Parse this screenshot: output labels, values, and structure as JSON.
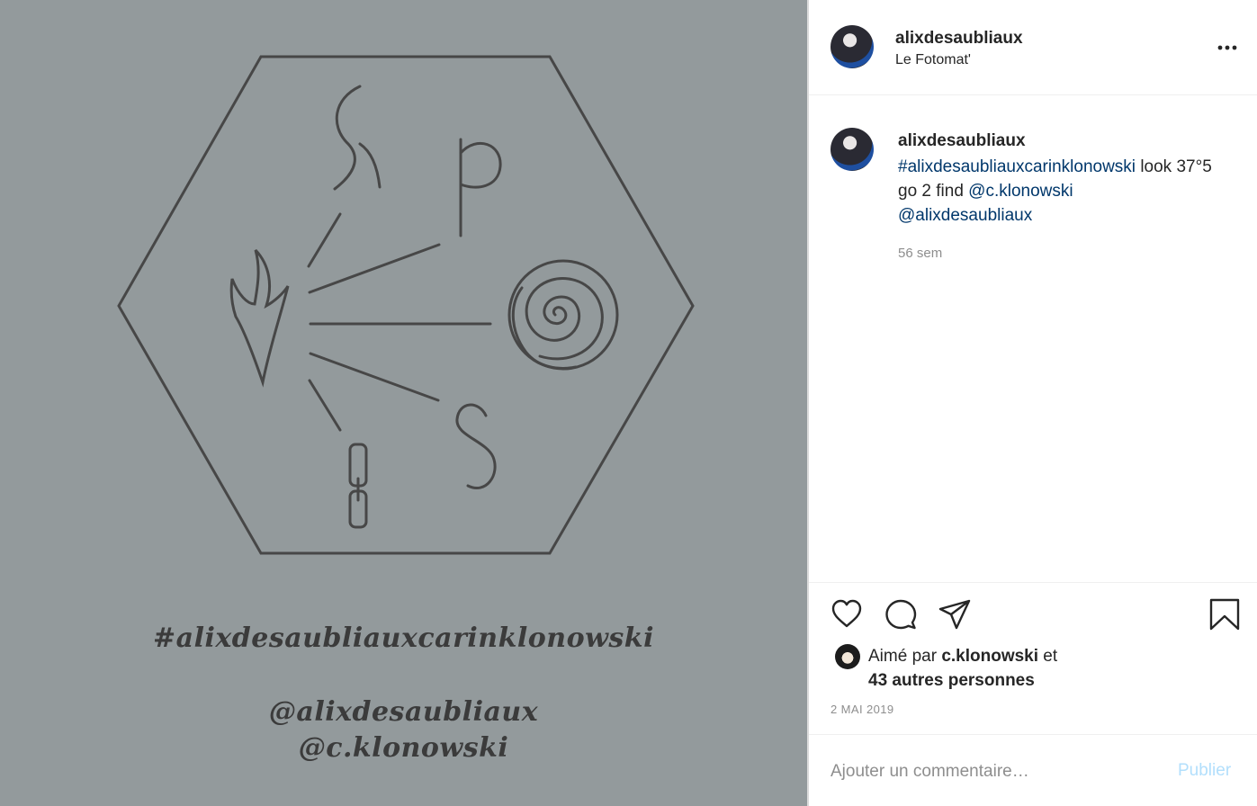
{
  "post_image": {
    "hashtag": "#alixdesaubliauxcarinklonowski",
    "handle_1": "@alixdesaubliaux",
    "handle_2": "@c.klonowski",
    "background_color": "#939a9c",
    "ink_color": "#3b3b3b"
  },
  "header": {
    "username": "alixdesaubliaux",
    "location": "Le Fotomat'",
    "more_icon": "more-horizontal-icon"
  },
  "caption": {
    "username": "alixdesaubliaux",
    "hashtag": "#alixdesaubliauxcarinklonowski",
    "text_1": " look 37°5 go 2 find ",
    "mention_1": "@c.klonowski",
    "mention_2": "@alixdesaubliaux",
    "time_ago": "56 sem"
  },
  "actions": {
    "like_icon": "heart-icon",
    "comment_icon": "comment-bubble-icon",
    "share_icon": "paper-plane-icon",
    "save_icon": "bookmark-icon"
  },
  "likes": {
    "prefix": "Aimé par ",
    "user": "c.klonowski",
    "middle": " et",
    "others": "43 autres personnes"
  },
  "date": "2 MAI 2019",
  "comment_box": {
    "placeholder": "Ajouter un commentaire…",
    "submit_label": "Publier"
  },
  "colors": {
    "link": "#00376b",
    "muted": "#8e8e8e",
    "publish_disabled": "#b2dffc"
  }
}
